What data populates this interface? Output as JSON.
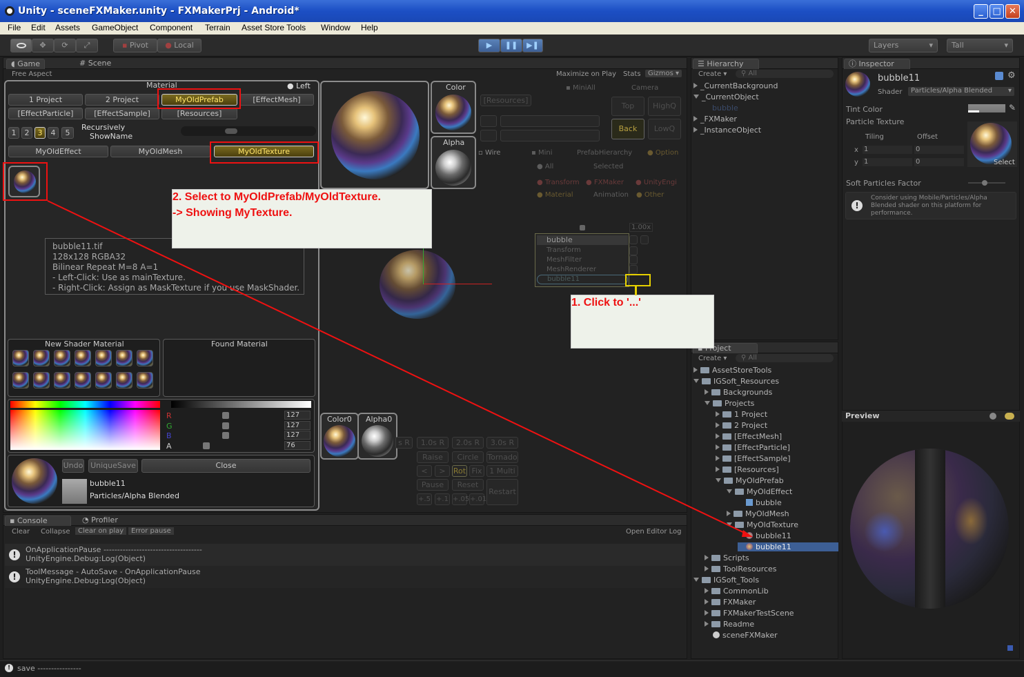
{
  "window": {
    "title": "Unity - sceneFXMaker.unity - FXMakerPrj - Android*",
    "min": "_",
    "max": "□",
    "close": "✕"
  },
  "menu": [
    "File",
    "Edit",
    "Assets",
    "GameObject",
    "Component",
    "Terrain",
    "Asset Store Tools",
    "Window",
    "Help"
  ],
  "toolbar": {
    "pivot": "Pivot",
    "local": "Local",
    "layers": "Layers",
    "layout": "Tall"
  },
  "game": {
    "tab_game": "Game",
    "tab_scene": "Scene",
    "aspect": "Free Aspect",
    "maximize": "Maximize on Play",
    "stats": "Stats",
    "gizmos": "Gizmos"
  },
  "fx": {
    "material_label": "Material",
    "left_label": "Left",
    "row1": [
      "1 Project",
      "2 Project",
      "MyOldPrefab",
      "[EffectMesh]"
    ],
    "row2": [
      "[EffectParticle]",
      "[EffectSample]",
      "[Resources]"
    ],
    "pages": [
      "1",
      "2",
      "3",
      "4",
      "5"
    ],
    "recursively": "Recursively",
    "showname": "ShowName",
    "tabs": [
      "MyOldEffect",
      "MyOldMesh",
      "MyOldTexture"
    ],
    "tooltip": [
      "bubble11.tif",
      "128x128 RGBA32",
      "Bilinear Repeat M=8 A=1",
      "- Left-Click: Use as mainTexture.",
      "- Right-Click: Assign as MaskTexture if you use MaskShader."
    ],
    "new_shader_label": "New Shader Material",
    "found_label": "Found Material",
    "rgba": {
      "r_label": "R",
      "g_label": "G",
      "b_label": "B",
      "a_label": "A",
      "r": "127",
      "g": "127",
      "b": "127",
      "a": "76"
    },
    "undo": "Undo",
    "uniquesave": "UniqueSave",
    "close": "Close",
    "mat_name": "bubble11",
    "shader_name": "Particles/Alpha Blended",
    "color_label": "Color",
    "alpha_label": "Alpha",
    "color0_label": "Color0",
    "alpha0_label": "Alpha0"
  },
  "scene": {
    "resources": "[Resources]",
    "miniall": "MiniAll",
    "camera": "Camera",
    "top": "Top",
    "highq": "HighQ",
    "back": "Back",
    "lowq": "LowQ",
    "wire": "Wire",
    "mini": "Mini",
    "prefabhier": "PrefabHierarchy",
    "option": "Option",
    "all": "All",
    "selected": "Selected",
    "transform": "Transform",
    "fxmaker": "FXMaker",
    "unityengi": "UnityEngi",
    "material": "Material",
    "animation": "Animation",
    "other": "Other",
    "zoom": "1.00x",
    "popup": [
      "bubble",
      "Transform",
      "MeshFilter",
      "MeshRenderer",
      "bubble11"
    ],
    "speed": [
      "s R",
      "1.0s R",
      "2.0s R",
      "3.0s R"
    ],
    "ctrl1": [
      "Raise",
      "Circle",
      "Tornado"
    ],
    "ctrl2": [
      "<",
      ">",
      "Rot",
      "Fix",
      "1 Multi"
    ],
    "pause": "Pause",
    "reset": "Reset",
    "restart": "Restart",
    "steps": [
      "+.5",
      "+.1",
      "+.05",
      "+.01"
    ]
  },
  "annotations": {
    "step2_line1": "2. Select to MyOldPrefab/MyOldTexture.",
    "step2_line2": "-> Showing MyTexture.",
    "step1": "1. Click to '...'"
  },
  "hierarchy": {
    "tab": "Hierarchy",
    "create": "Create ▾",
    "search": "All",
    "items": [
      "_CurrentBackground",
      "_CurrentObject",
      "bubble",
      "_FXMaker",
      "_InstanceObject"
    ]
  },
  "inspector": {
    "tab": "Inspector",
    "name": "bubble11",
    "shader_label": "Shader",
    "shader": "Particles/Alpha Blended",
    "tint": "Tint Color",
    "particle_tex": "Particle Texture",
    "tiling": "Tiling",
    "offset": "Offset",
    "x_label": "x",
    "y_label": "y",
    "tx": "1",
    "ty": "1",
    "ox": "0",
    "oy": "0",
    "select": "Select",
    "soft": "Soft Particles Factor",
    "warning": "Consider using Mobile/Particles/Alpha Blended shader on this platform for performance.",
    "preview": "Preview"
  },
  "project": {
    "tab": "Project",
    "create": "Create ▾",
    "search": "All",
    "items": [
      "AssetStoreTools",
      "IGSoft_Resources",
      "Backgrounds",
      "Projects",
      "1 Project",
      "2 Project",
      "[EffectMesh]",
      "[EffectParticle]",
      "[EffectSample]",
      "[Resources]",
      "MyOldPrefab",
      "MyOldEffect",
      "bubble",
      "MyOldMesh",
      "MyOldTexture",
      "bubble11",
      "bubble11",
      "Scripts",
      "ToolResources",
      "IGSoft_Tools",
      "CommonLib",
      "FXMaker",
      "FXMakerTestScene",
      "Readme",
      "sceneFXMaker"
    ]
  },
  "console": {
    "tab": "Console",
    "profiler": "Profiler",
    "clear": "Clear",
    "collapse": "Collapse",
    "clear_on_play": "Clear on play",
    "error_pause": "Error pause",
    "open_log": "Open Editor Log",
    "logs": [
      {
        "l1": "OnApplicationPause ------------------------------------",
        "l2": "UnityEngine.Debug:Log(Object)"
      },
      {
        "l1": "ToolMessage - AutoSave - OnApplicationPause",
        "l2": "UnityEngine.Debug:Log(Object)"
      }
    ],
    "status": "save ----------------"
  },
  "colors": {
    "highlight": "#ffe56a",
    "annotation": "#ee1111",
    "selection": "#3d5f95"
  }
}
